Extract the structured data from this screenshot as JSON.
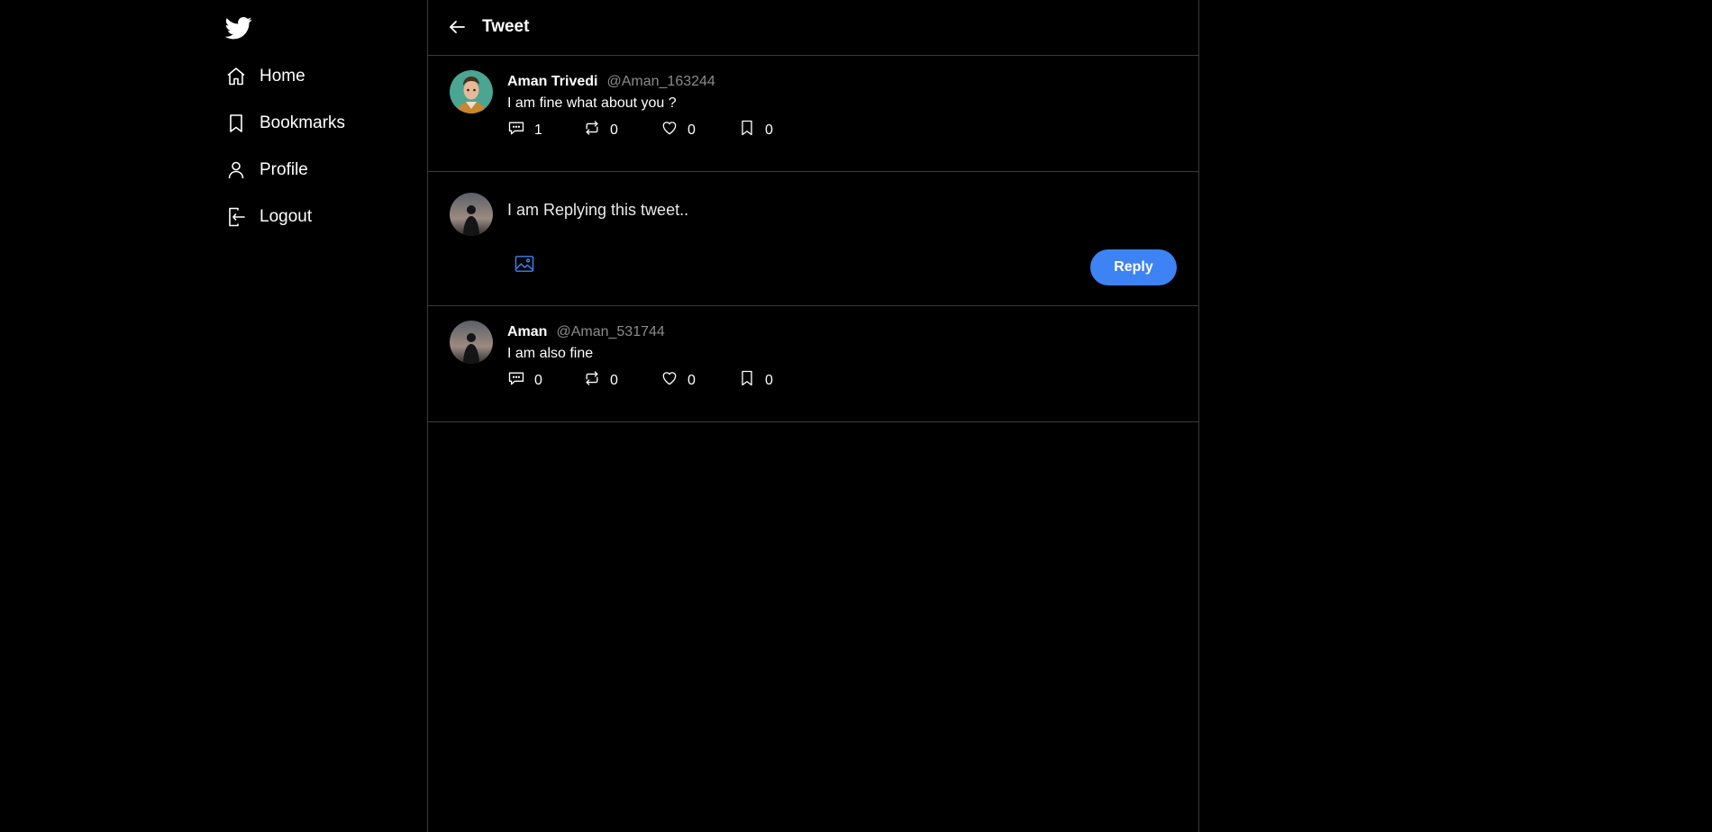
{
  "sidebar": {
    "logo_icon": "twitter-bird-icon",
    "items": [
      {
        "label": "Home",
        "icon": "home-icon"
      },
      {
        "label": "Bookmarks",
        "icon": "bookmark-icon"
      },
      {
        "label": "Profile",
        "icon": "user-icon"
      },
      {
        "label": "Logout",
        "icon": "logout-icon"
      }
    ]
  },
  "header": {
    "title": "Tweet",
    "back_icon": "arrow-left-icon"
  },
  "main_tweet": {
    "name": "Aman Trivedi",
    "handle": "@Aman_163244",
    "content": "I am fine what about you ?",
    "replies": "1",
    "retweets": "0",
    "likes": "0",
    "bookmarks": "0"
  },
  "reply_box": {
    "input_value": "I am Replying this tweet..",
    "image_icon": "image-icon",
    "button_label": "Reply"
  },
  "reply_tweet": {
    "name": "Aman",
    "handle": "@Aman_531744",
    "content": "I am also fine",
    "replies": "0",
    "retweets": "0",
    "likes": "0",
    "bookmarks": "0"
  },
  "colors": {
    "background": "#000000",
    "accent": "#3d83f3",
    "divider": "#3a3a3a",
    "muted": "#8b8b8b"
  }
}
